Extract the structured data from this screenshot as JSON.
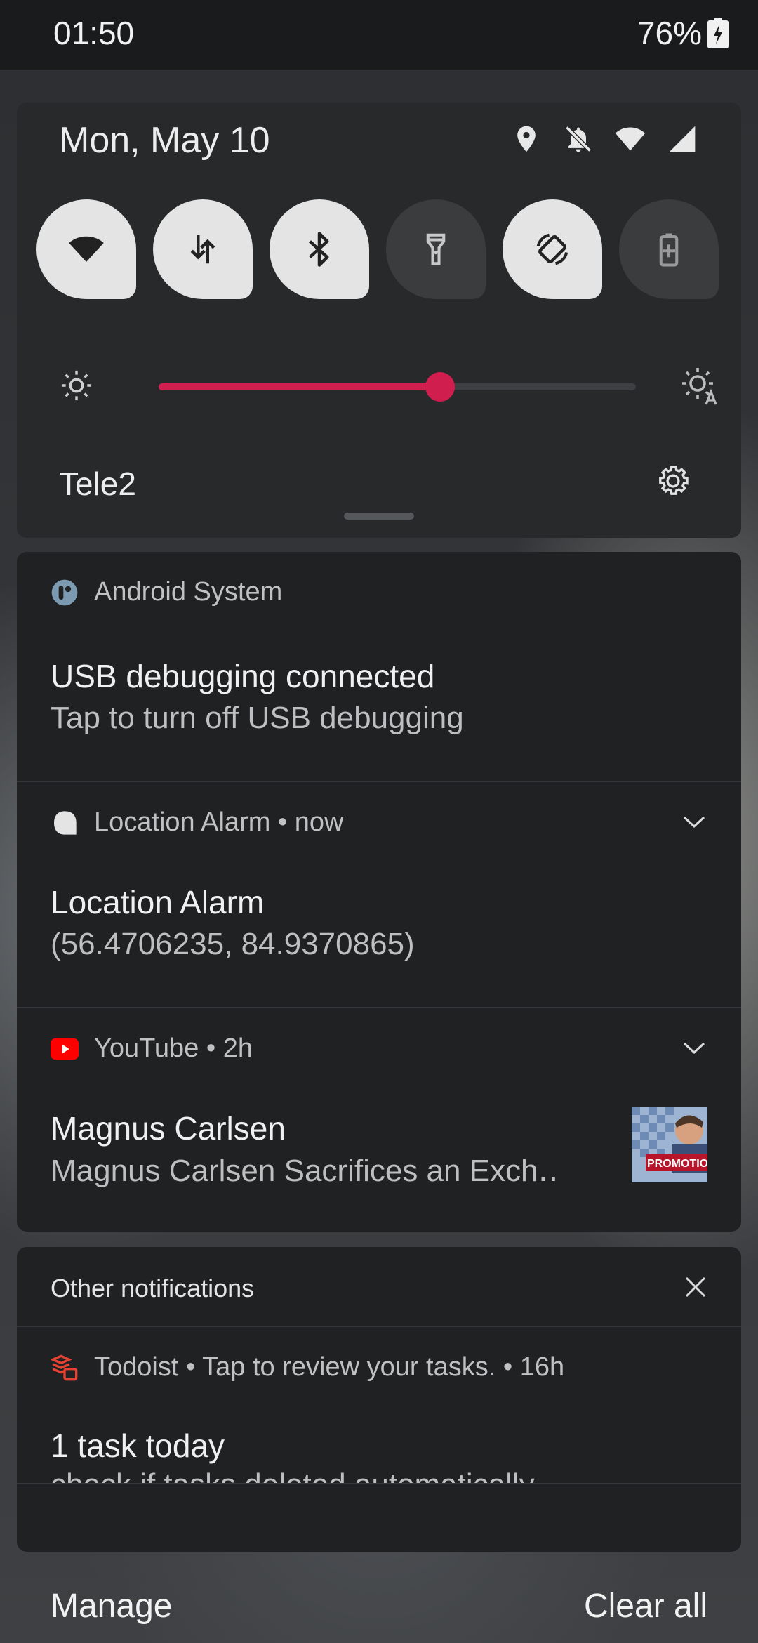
{
  "status_bar": {
    "time": "01:50",
    "battery": "76%"
  },
  "quick_settings": {
    "date": "Mon, May 10",
    "tiles": [
      {
        "name": "wifi",
        "on": true
      },
      {
        "name": "mobile-data",
        "on": true
      },
      {
        "name": "bluetooth",
        "on": true
      },
      {
        "name": "flashlight",
        "on": false
      },
      {
        "name": "auto-rotate",
        "on": true
      },
      {
        "name": "battery-saver",
        "on": false
      }
    ],
    "brightness_level": 0.59,
    "operator": "Tele2"
  },
  "notifications": [
    {
      "app": "Android System",
      "title": "USB debugging connected",
      "text": "Tap to turn off USB debugging"
    },
    {
      "app": "Location Alarm • now",
      "title": "Location Alarm",
      "text": "(56.4706235, 84.9370865)"
    },
    {
      "app": "YouTube • 2h",
      "title": "Magnus Carlsen",
      "text": "Magnus Carlsen Sacrifices an Exch‥",
      "thumbnail_text": "PROMOTIO"
    }
  ],
  "other_notifications": {
    "header": "Other notifications",
    "item": {
      "app": "Todoist • Tap to review your tasks. • 16h",
      "title": "1 task today",
      "text": "check if tasks deleted automatically"
    }
  },
  "footer": {
    "manage": "Manage",
    "clear_all": "Clear all"
  },
  "colors": {
    "accent": "#d01e4e",
    "panel": "#27292b",
    "card": "#1f2123"
  }
}
